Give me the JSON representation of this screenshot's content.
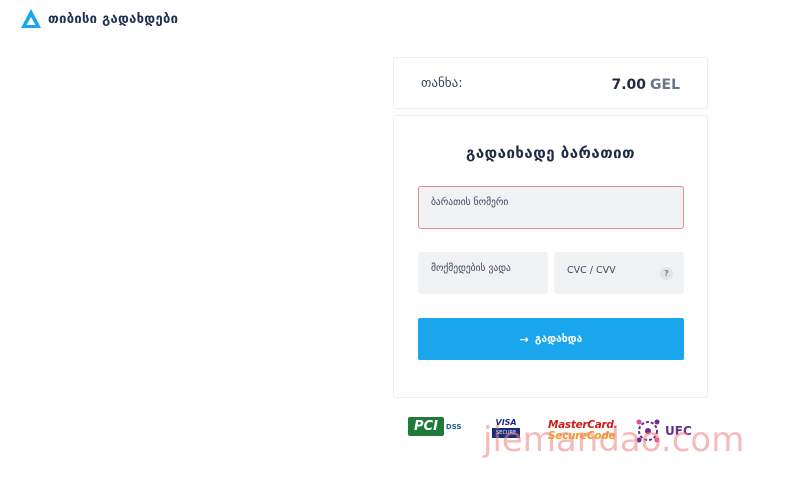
{
  "brand": {
    "name": "თიბისი გადახდები",
    "accent_color": "#1aa6ec",
    "logo_icon": "triangle-logo-icon"
  },
  "amount": {
    "label": "თანხა:",
    "value": "7.00",
    "currency": "GEL"
  },
  "payment_form": {
    "title": "გადაიხადე ბარათით",
    "card_number_placeholder": "ბარათის ნომერი",
    "expiry_placeholder": "მოქმედების ვადა",
    "cvc_placeholder": "CVC / CVV",
    "cvc_help": "?",
    "pay_button_icon": "arrow-right-icon",
    "pay_button_label": "გადახდა"
  },
  "security_badges": {
    "pci_main": "PCI",
    "pci_sub": "DSS",
    "visa_top": "VISA",
    "visa_sub": "SECURE",
    "mastercard_line1": "MasterCard.",
    "mastercard_line2": "SecureCode",
    "ufc": "UFC"
  },
  "watermark": "jiemandao.com"
}
